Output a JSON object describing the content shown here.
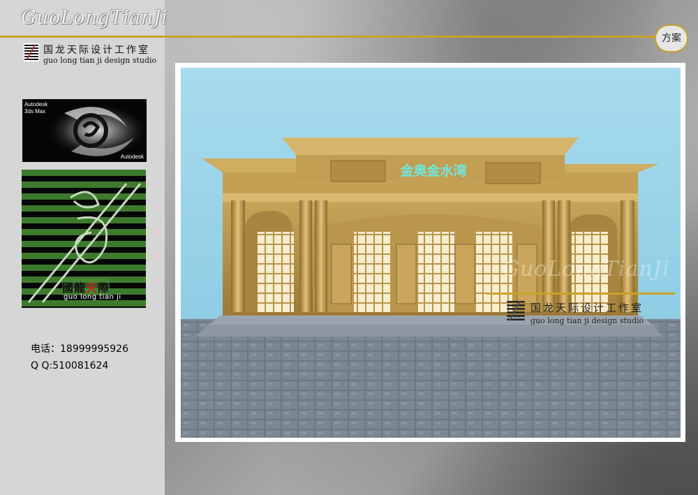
{
  "header": {
    "brand_script": "GuoLongTianJi",
    "studio_name_cn": "国龙天际设计工作室",
    "studio_name_en": "guo long tian ji design studio",
    "badge": "方案"
  },
  "sidebar": {
    "autodesk_line1": "Autodesk",
    "autodesk_line2": "3ds Max",
    "autodesk_footer": "Autodesk",
    "logo_cn": [
      "國",
      "龍",
      "天",
      "際"
    ],
    "logo_en": "guo long tian ji",
    "phone": "电话：18999995926",
    "qq": "Q Q:510081624"
  },
  "render": {
    "sign_text": "金奥金水湾",
    "watermark_script": "GuoLongTianJi",
    "watermark_cn": "国龙天际设计工作室",
    "watermark_en": "guo long tian ji design studio"
  },
  "colors": {
    "accent_gold": "#c9a227",
    "sign_cyan": "#6ee8e0",
    "sky": "#9fd6ea",
    "stone": "#b89448"
  }
}
